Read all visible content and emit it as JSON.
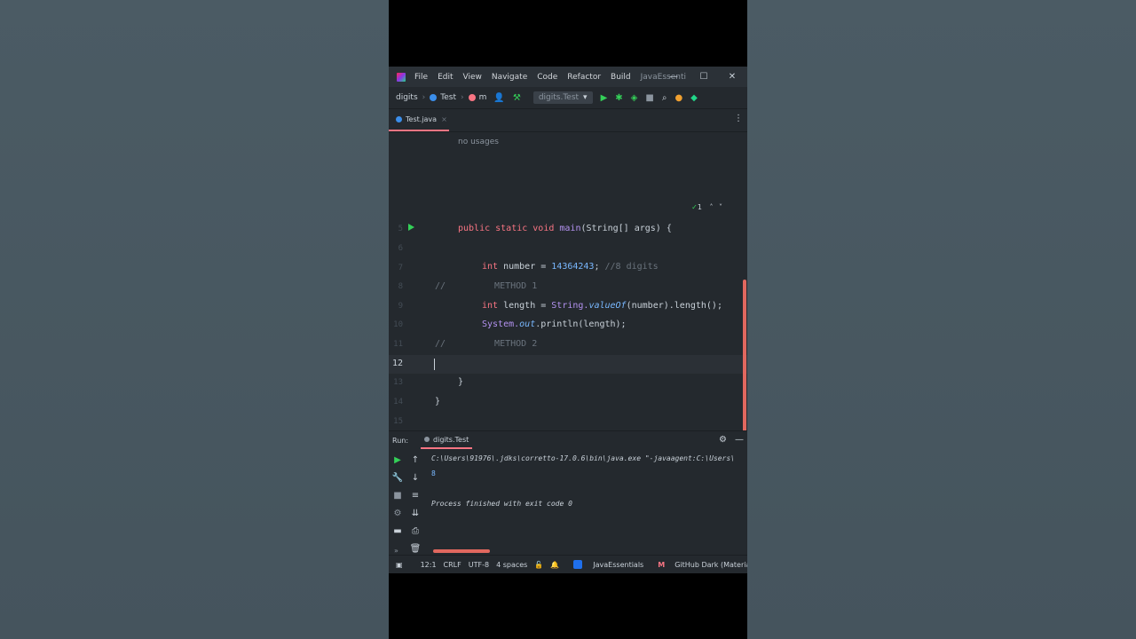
{
  "menu": {
    "items": [
      "File",
      "Edit",
      "View",
      "Navigate",
      "Code",
      "Refactor",
      "Build"
    ],
    "project_title": "JavaEssenti",
    "minimize": "—",
    "maximize": "☐",
    "close": "✕"
  },
  "nav": {
    "project": "digits",
    "file": "Test",
    "member": "m",
    "run_config": "digits.Test"
  },
  "tab": {
    "label": "Test.java",
    "close": "×"
  },
  "editor": {
    "hint": "no usages",
    "inspection_count": "1",
    "line_numbers": [
      "5",
      "6",
      "7",
      "8",
      "9",
      "10",
      "11",
      "12",
      "13",
      "14",
      "15"
    ],
    "current_line": "12",
    "code": {
      "l5_kw": "public static void ",
      "l5_fn": "main",
      "l5_rest": "(String[] args) {",
      "l7_kw": "int ",
      "l7_var": "number = ",
      "l7_num": "14364243",
      "l7_semi": "; ",
      "l7_cm": "//8 digits",
      "l8_slash": "//",
      "l8_cm": "METHOD 1",
      "l9_kw": "int ",
      "l9_var": "length = ",
      "l9_cls": "String.",
      "l9_fn": "valueOf",
      "l9_rest": "(number).length();",
      "l10_cls": "System.",
      "l10_field": "out",
      "l10_rest": ".println(length);",
      "l11_slash": "//",
      "l11_cm": "METHOD 2",
      "l13": "}",
      "l14": "}"
    }
  },
  "run": {
    "label": "Run:",
    "tab": "digits.Test",
    "cmd": "C:\\Users\\91976\\.jdks\\corretto-17.0.6\\bin\\java.exe \"-javaagent:C:\\Users\\",
    "output": "8",
    "finish": "Process finished with exit code 0"
  },
  "status": {
    "position": "12:1",
    "line_sep": "CRLF",
    "encoding": "UTF-8",
    "indent": "4 spaces",
    "project": "JavaEssentials",
    "theme": "GitHub Dark (Material)"
  }
}
